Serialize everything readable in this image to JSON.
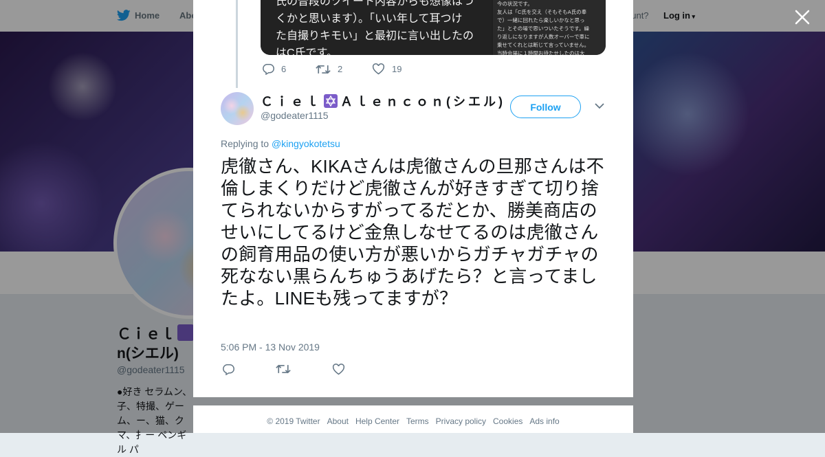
{
  "topbar": {
    "home_label": "Home",
    "about_label": "Abo",
    "account_label": "ccount?",
    "login_label": "Log in"
  },
  "background_profile": {
    "name_line1": "Ｃｉｅｌ",
    "name_line2": "n(シエル)",
    "handle": "@godeater1115",
    "bio": "●好き セラムン、子、特撮、ゲーム、ー、猫、クマ、扌ー ペンギル パ"
  },
  "media": {
    "left_lines": [
      "氏の普段のツイート内容からも想像はつ",
      "くかと思います）。「いい年して耳つけ",
      "た自撮りキモい」と最初に言い出したの",
      "はC氏です。"
    ],
    "right_lines": [
      "今の状況です。",
      "友人は「C氏を交え（そもそもA氏の奉",
      "で）一緒に回れたら楽しいかなと思っ",
      "た」とその場で思いついたそうです。繰",
      "り返しになりますが人数オーバーで車に",
      "乗せてくれとは断じて言っていません。",
      "当時会場に１時間お待たせしたのは大"
    ]
  },
  "prev_tweet": {
    "reply_count": "6",
    "retweet_count": "2",
    "like_count": "19"
  },
  "tweet": {
    "author_name_part1": "Ｃｉｅｌ",
    "author_name_part2": "Ａｌｅｎｃｏｎ(シエル)",
    "author_handle": "@godeater1115",
    "follow_label": "Follow",
    "replying_prefix": "Replying to",
    "replying_handle": "@kingyokotetsu",
    "text": "虎徹さん、KIKAさんは虎徹さんの旦那さんは不倫しまくりだけど虎徹さんが好きすぎて切り捨てられないからすがってるだとか、勝美商店のせいにしてるけど金魚しなせてるのは虎徹さんの飼育用品の使い方が悪いからガチャガチャの死なない黒らんちゅうあげたら？と言ってましたよ。LINEも残ってますが？",
    "timestamp": "5:06 PM - 13 Nov 2019"
  },
  "footer": {
    "links": [
      "© 2019 Twitter",
      "About",
      "Help Center",
      "Terms",
      "Privacy policy",
      "Cookies",
      "Ads info"
    ]
  },
  "colors": {
    "twitter_blue": "#1da1f2",
    "text_primary": "#14171a",
    "text_secondary": "#657786"
  },
  "icons": [
    "twitter-bird-icon",
    "close-icon",
    "reply-icon",
    "retweet-icon",
    "like-icon",
    "chevron-down-icon",
    "star-of-david-emoji"
  ]
}
